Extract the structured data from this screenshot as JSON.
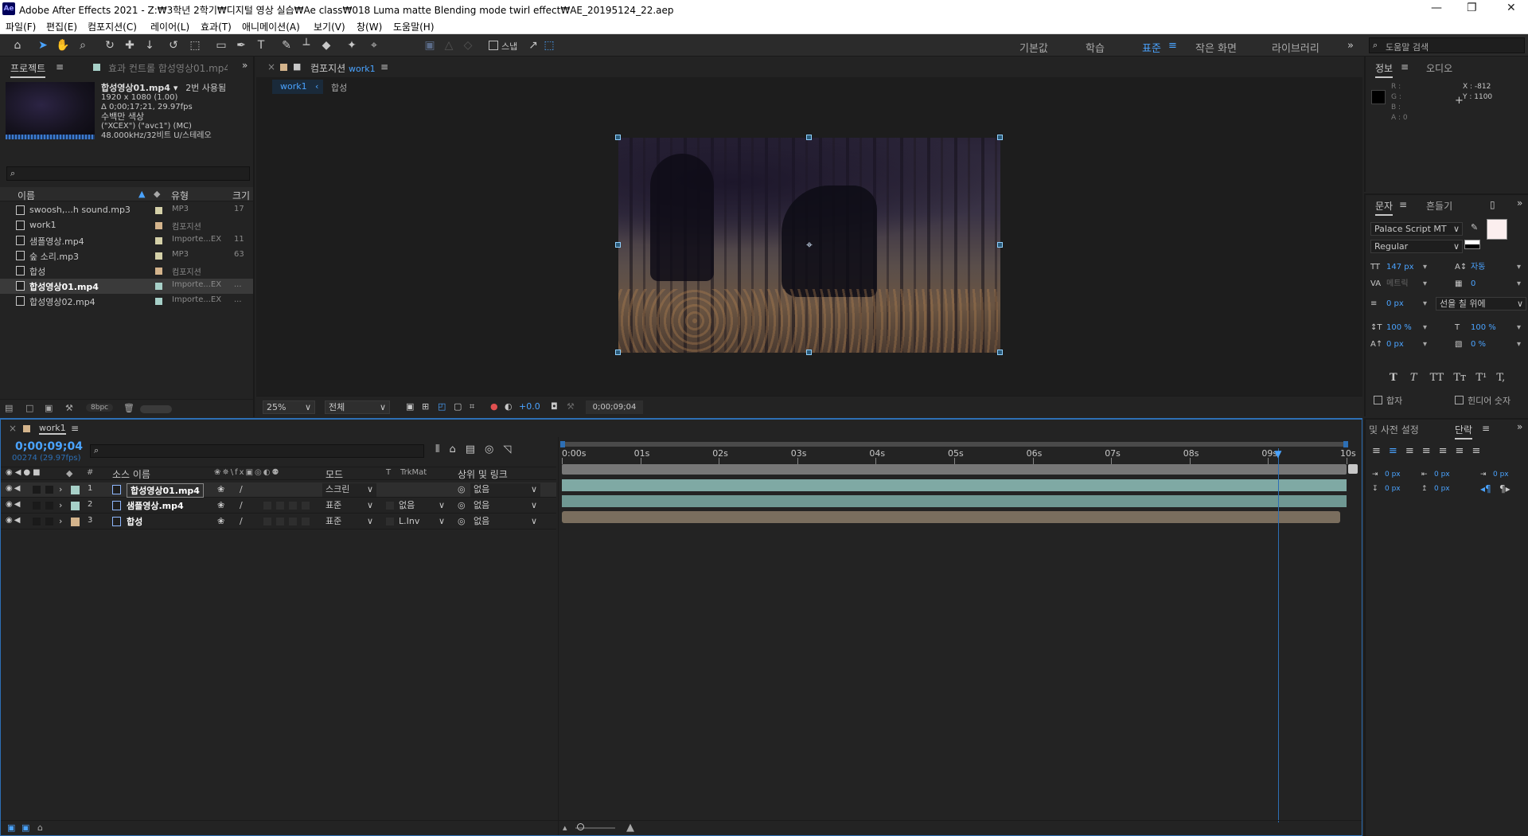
{
  "window": {
    "app_icon": "Ae",
    "title": "Adobe After Effects 2021 - Z:₩3학년 2학기₩디지털 영상 실습₩Ae class₩018  Luma matte  Blending mode  twirl effect₩AE_20195124_22.aep"
  },
  "menu": [
    "파일(F)",
    "편집(E)",
    "컴포지션(C)",
    "레이어(L)",
    "효과(T)",
    "애니메이션(A)",
    "보기(V)",
    "창(W)",
    "도움말(H)"
  ],
  "toolbar": {
    "snap_label": "스냅",
    "workspaces": [
      "기본값",
      "학습",
      "표준",
      "작은 화면",
      "라이브러리"
    ],
    "active_workspace": "표준",
    "help_search_placeholder": "도움말 검색"
  },
  "project_panel": {
    "tab_label": "프로젝트",
    "effect_tab_label": "효과 컨트롤 합성영상01.mp4",
    "selected_name": "합성영상01.mp4",
    "used_count": "2번 사용됨",
    "resolution": "1920 x 1080 (1.00)",
    "duration": "Δ 0;00;17;21, 29.97fps",
    "colors": "수백만 색상",
    "codec": "(\"XCEX\") (\"avc1\") (MC)",
    "audio": "48.000kHz/32비트 U/스테레오",
    "search_placeholder": "",
    "columns": {
      "name": "이름",
      "type": "유형",
      "size": "크기"
    },
    "items": [
      {
        "name": "swoosh,...h sound.mp3",
        "type": "MP3",
        "size": "17",
        "label_color": "#d4d0a8",
        "icon": "audio-file-icon"
      },
      {
        "name": "work1",
        "type": "컴포지션",
        "size": "",
        "label_color": "#d4b48c",
        "icon": "composition-icon"
      },
      {
        "name": "샘플영상.mp4",
        "type": "Importe...EX",
        "size": "11",
        "label_color": "#d4d0a8",
        "icon": "video-file-icon"
      },
      {
        "name": "숲 소리.mp3",
        "type": "MP3",
        "size": "63",
        "label_color": "#d4d0a8",
        "icon": "audio-file-icon"
      },
      {
        "name": "합성",
        "type": "컴포지션",
        "size": "",
        "label_color": "#d4b48c",
        "icon": "composition-icon"
      },
      {
        "name": "합성영상01.mp4",
        "type": "Importe...EX",
        "size": "...",
        "label_color": "#a7d0c8",
        "icon": "video-file-icon",
        "selected": true
      },
      {
        "name": "합성영상02.mp4",
        "type": "Importe...EX",
        "size": "...",
        "label_color": "#a7d0c8",
        "icon": "video-file-icon"
      }
    ],
    "bpc": "8bpc"
  },
  "composition_panel": {
    "tab_prefix": "컴포지션",
    "tab_name": "work1",
    "breadcrumb": [
      "work1",
      "합성"
    ],
    "zoom": "25%",
    "resolution": "전체",
    "exposure": "+0.0",
    "timecode": "0;00;09;04"
  },
  "info_panel": {
    "tab_info": "정보",
    "tab_audio": "오디오",
    "r": "R :",
    "g": "G :",
    "b": "B :",
    "a": "A : 0",
    "x": "X : -812",
    "y": "Y : 1100"
  },
  "character_panel": {
    "tab_label": "문자",
    "tab2_label": "흔들기",
    "font": "Palace Script MT",
    "style": "Regular",
    "size": "147 px",
    "leading": "자동",
    "kerning": "메트릭",
    "tracking": "0",
    "stroke_width": "0 px",
    "stroke_type": "선을 칠 위에",
    "vscale": "100 %",
    "hscale": "100 %",
    "baseline": "0 px",
    "tsume": "0 %",
    "style_buttons": [
      "T",
      "T",
      "TT",
      "Tт",
      "T¹",
      "T,"
    ],
    "ligature": "합자",
    "hindi": "힌디어 숫자"
  },
  "paragraph_panel": {
    "tab_presets": "및 사전 설정",
    "tab_label": "단락",
    "indent_values": [
      "0 px",
      "0 px",
      "0 px",
      "0 px",
      "0 px"
    ]
  },
  "timeline": {
    "tab_label": "work1",
    "timecode": "0;00;09;04",
    "frame_info": "00274 (29.97fps)",
    "columns": {
      "source": "소스 이름",
      "mode": "모드",
      "t": "T",
      "trkmat": "TrkMat",
      "parent": "상위 및 링크"
    },
    "ruler": [
      "0:00s",
      "01s",
      "02s",
      "03s",
      "04s",
      "05s",
      "06s",
      "07s",
      "08s",
      "09s",
      "10s"
    ],
    "layers": [
      {
        "num": "1",
        "name": "합성영상01.mp4",
        "mode": "스크린",
        "trkmat": "",
        "parent": "없음",
        "label_color": "#a7d0c8",
        "bar_color": "#7fa9a4",
        "selected": true
      },
      {
        "num": "2",
        "name": "샘플영상.mp4",
        "mode": "표준",
        "trkmat": "없음",
        "parent": "없음",
        "label_color": "#a7d0c8",
        "bar_color": "#6f9893"
      },
      {
        "num": "3",
        "name": "합성",
        "mode": "표준",
        "trkmat": "L.Inv",
        "parent": "없음",
        "label_color": "#d4b48c",
        "bar_color": "#7a6e5e"
      }
    ],
    "playhead_time": 9.13,
    "duration": 10
  }
}
